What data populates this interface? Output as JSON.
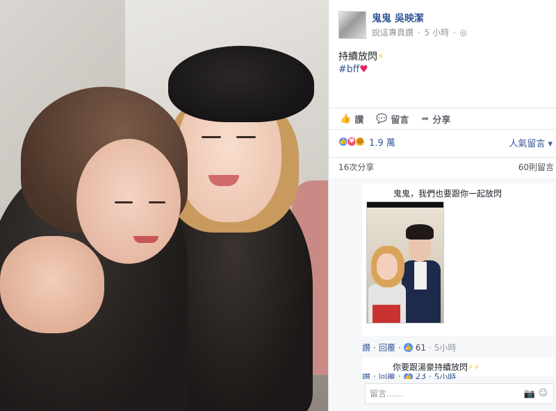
{
  "post": {
    "author": "鬼鬼 吳映潔",
    "meta_follow": "說這專頁讚",
    "meta_time": "5 小時",
    "dot": "·",
    "globe": "◎",
    "text": "持續放閃",
    "bolt": "⚡",
    "hashtag": "#bff",
    "heart": "♥"
  },
  "actions": {
    "like": "讚",
    "comment": "留言",
    "share": "分享",
    "like_icon": "👍",
    "comment_icon": "💬",
    "share_icon": "➦"
  },
  "reactions": {
    "count": "1.9 萬",
    "sort_label": "人氣留言",
    "sort_arrow": "▾",
    "like_glyph": "👍",
    "love_glyph": "♥",
    "haha_glyph": "😆"
  },
  "stats": {
    "shares": "16次分享",
    "comments": "60則留言"
  },
  "comment1": {
    "text": "鬼鬼，我們也要跟你一起放閃",
    "like": "讚",
    "sep": "·",
    "reply": "回覆",
    "likes": "61",
    "time": "5小時"
  },
  "reply": {
    "text": "你要跟湯豪持續放閃",
    "bolts": "⚡⚡",
    "like": "讚",
    "reply": "回覆",
    "likes": "23",
    "time": "5小時"
  },
  "comment_box": {
    "placeholder": "留言……",
    "camera_icon": "📷",
    "emoji_icon": "☺"
  },
  "colors": {
    "link": "#365899",
    "like_blue": "#5890ff",
    "love_red": "#f25268",
    "haha_yellow": "#f7b125"
  }
}
